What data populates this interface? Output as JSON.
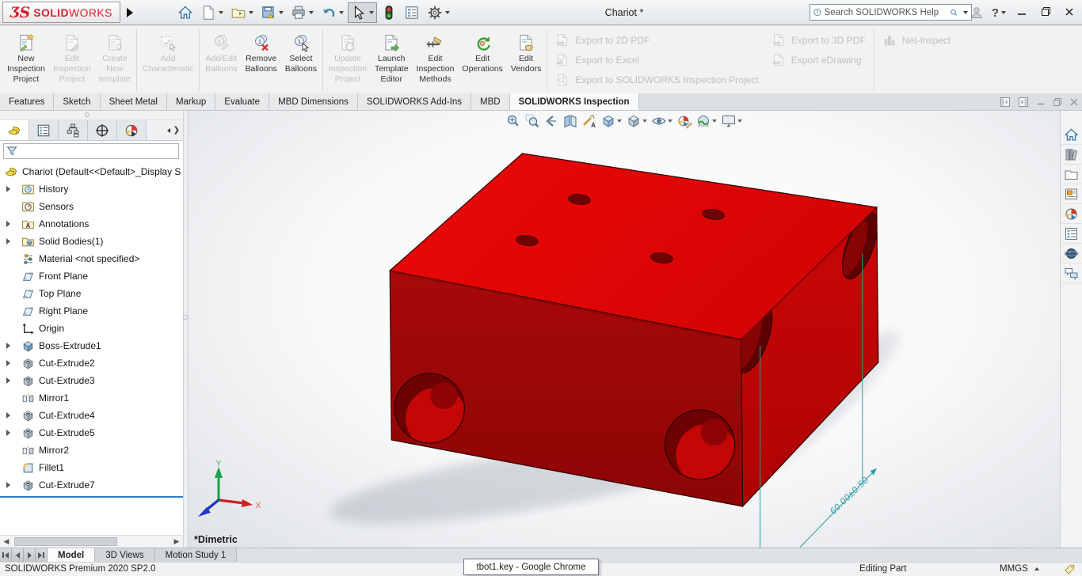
{
  "titlebar": {
    "logo_prefix": "ƷS",
    "logo_bold": "SOLID",
    "logo_light": "WORKS",
    "document_title": "Chariot *",
    "search_placeholder": "Search SOLIDWORKS Help",
    "help_label": "?",
    "toolbar": [
      {
        "name": "home-icon",
        "dropdown": false,
        "pressed": false
      },
      {
        "name": "new-document-icon",
        "dropdown": true,
        "pressed": false
      },
      {
        "name": "open-icon",
        "dropdown": true,
        "pressed": false
      },
      {
        "name": "save-icon",
        "dropdown": true,
        "pressed": false
      },
      {
        "name": "print-icon",
        "dropdown": true,
        "pressed": false
      },
      {
        "name": "undo-icon",
        "dropdown": true,
        "pressed": false
      },
      {
        "name": "select-icon",
        "dropdown": true,
        "pressed": true
      },
      {
        "name": "rebuild-icon",
        "dropdown": false,
        "pressed": false
      },
      {
        "name": "options-list-icon",
        "dropdown": false,
        "pressed": false
      },
      {
        "name": "settings-icon",
        "dropdown": true,
        "pressed": false
      }
    ]
  },
  "ribbon": {
    "groups": [
      {
        "type": "large",
        "buttons": [
          {
            "label": "New\nInspection\nProject",
            "icon": "new-inspection-project-icon",
            "enabled": true
          },
          {
            "label": "Edit\nInspection\nProject",
            "icon": "edit-inspection-project-icon",
            "enabled": false
          },
          {
            "label": "Create\nNew\ntemplate",
            "icon": "create-new-template-icon",
            "enabled": false
          }
        ]
      },
      {
        "type": "large",
        "buttons": [
          {
            "label": "Add\nCharacteristic",
            "icon": "add-characteristic-icon",
            "enabled": false
          }
        ]
      },
      {
        "type": "large",
        "buttons": [
          {
            "label": "Add/Edit\nBalloons",
            "icon": "add-edit-balloons-icon",
            "enabled": false
          },
          {
            "label": "Remove\nBalloons",
            "icon": "remove-balloons-icon",
            "enabled": true
          },
          {
            "label": "Select\nBalloons",
            "icon": "select-balloons-icon",
            "enabled": true
          }
        ]
      },
      {
        "type": "large",
        "buttons": [
          {
            "label": "Update\nInspection\nProject",
            "icon": "update-inspection-project-icon",
            "enabled": false
          },
          {
            "label": "Launch\nTemplate\nEditor",
            "icon": "launch-template-editor-icon",
            "enabled": true
          },
          {
            "label": "Edit\nInspection\nMethods",
            "icon": "edit-inspection-methods-icon",
            "enabled": true
          },
          {
            "label": "Edit\nOperations",
            "icon": "edit-operations-icon",
            "enabled": true
          },
          {
            "label": "Edit\nVendors",
            "icon": "edit-vendors-icon",
            "enabled": true
          }
        ]
      },
      {
        "type": "stack",
        "buttons": [
          {
            "label": "Export to 2D PDF",
            "icon": "export-2d-pdf-icon",
            "enabled": false
          },
          {
            "label": "Export to Excel",
            "icon": "export-excel-icon",
            "enabled": false
          },
          {
            "label": "Export to SOLIDWORKS Inspection Project",
            "icon": "export-sw-inspection-icon",
            "enabled": false
          }
        ]
      },
      {
        "type": "stack",
        "nodiv": true,
        "buttons": [
          {
            "label": "Export to 3D PDF",
            "icon": "export-3d-pdf-icon",
            "enabled": false
          },
          {
            "label": "Export eDrawing",
            "icon": "export-edrawing-icon",
            "enabled": false
          }
        ]
      },
      {
        "type": "stack",
        "buttons": [
          {
            "label": "Net-Inspect",
            "icon": "net-inspect-icon",
            "enabled": false
          }
        ]
      }
    ]
  },
  "command_tabs": {
    "tabs": [
      "Features",
      "Sketch",
      "Sheet Metal",
      "Markup",
      "Evaluate",
      "MBD Dimensions",
      "SOLIDWORKS Add-Ins",
      "MBD",
      "SOLIDWORKS Inspection"
    ],
    "active": "SOLIDWORKS Inspection"
  },
  "feature_panel": {
    "tabs": [
      "feature-manager-icon",
      "configuration-manager-icon",
      "property-manager-icon",
      "dimxpert-manager-icon",
      "display-manager-icon"
    ],
    "active_tab": "feature-manager-icon",
    "filter_value": "",
    "tree": [
      {
        "label": "Chariot  (Default<<Default>_Display S",
        "icon": "part-icon",
        "root": true,
        "expandable": false
      },
      {
        "label": "History",
        "icon": "history-icon",
        "expandable": true
      },
      {
        "label": "Sensors",
        "icon": "sensors-icon",
        "expandable": false
      },
      {
        "label": "Annotations",
        "icon": "annotations-icon",
        "expandable": true
      },
      {
        "label": "Solid Bodies(1)",
        "icon": "solid-bodies-icon",
        "expandable": true
      },
      {
        "label": "Material <not specified>",
        "icon": "material-icon",
        "expandable": false
      },
      {
        "label": "Front Plane",
        "icon": "plane-icon",
        "expandable": false
      },
      {
        "label": "Top Plane",
        "icon": "plane-icon",
        "expandable": false
      },
      {
        "label": "Right Plane",
        "icon": "plane-icon",
        "expandable": false
      },
      {
        "label": "Origin",
        "icon": "origin-icon",
        "expandable": false
      },
      {
        "label": "Boss-Extrude1",
        "icon": "boss-extrude-icon",
        "expandable": true
      },
      {
        "label": "Cut-Extrude2",
        "icon": "cut-extrude-icon",
        "expandable": true
      },
      {
        "label": "Cut-Extrude3",
        "icon": "cut-extrude-icon",
        "expandable": true
      },
      {
        "label": "Mirror1",
        "icon": "mirror-icon",
        "expandable": false
      },
      {
        "label": "Cut-Extrude4",
        "icon": "cut-extrude-icon",
        "expandable": true
      },
      {
        "label": "Cut-Extrude5",
        "icon": "cut-extrude-icon",
        "expandable": true
      },
      {
        "label": "Mirror2",
        "icon": "mirror-icon",
        "expandable": false
      },
      {
        "label": "Fillet1",
        "icon": "fillet-icon",
        "expandable": false
      },
      {
        "label": "Cut-Extrude7",
        "icon": "cut-extrude-icon",
        "expandable": true
      }
    ]
  },
  "headsup_toolbar": [
    {
      "name": "zoom-to-fit-icon",
      "dropdown": false
    },
    {
      "name": "zoom-to-area-icon",
      "dropdown": false
    },
    {
      "name": "previous-view-icon",
      "dropdown": false
    },
    {
      "name": "section-view-icon",
      "dropdown": false
    },
    {
      "name": "dynamic-annotation-views-icon",
      "dropdown": false
    },
    {
      "name": "view-orientation-icon",
      "dropdown": true
    },
    {
      "name": "display-style-icon",
      "dropdown": true
    },
    {
      "name": "hide-show-items-icon",
      "dropdown": true
    },
    {
      "name": "edit-appearance-icon",
      "dropdown": false
    },
    {
      "name": "apply-scene-icon",
      "dropdown": true
    },
    {
      "name": "view-settings-icon",
      "dropdown": true
    }
  ],
  "task_pane": [
    "home-icon",
    "design-library-icon",
    "file-explorer-icon",
    "view-palette-icon",
    "appearances-icon",
    "custom-properties-icon",
    "forum-icon",
    "comments-icon"
  ],
  "viewport": {
    "view_name": "*Dimetric",
    "dimension_text": "60.00±0.50",
    "triad": {
      "x_label": "X",
      "y_label": "Y"
    },
    "colors": {
      "top_face": "#e20606",
      "front_face": "#9c0707",
      "right_face": "#c20505",
      "dimension": "#2f9e9e"
    }
  },
  "doc_tabs": {
    "tabs": [
      "Model",
      "3D Views",
      "Motion Study 1"
    ],
    "active": "Model"
  },
  "statusbar": {
    "version": "SOLIDWORKS Premium 2020 SP2.0",
    "taskbar_tooltip": "tbot1.key - Google Chrome",
    "mode": "Editing Part",
    "units": "MMGS"
  }
}
